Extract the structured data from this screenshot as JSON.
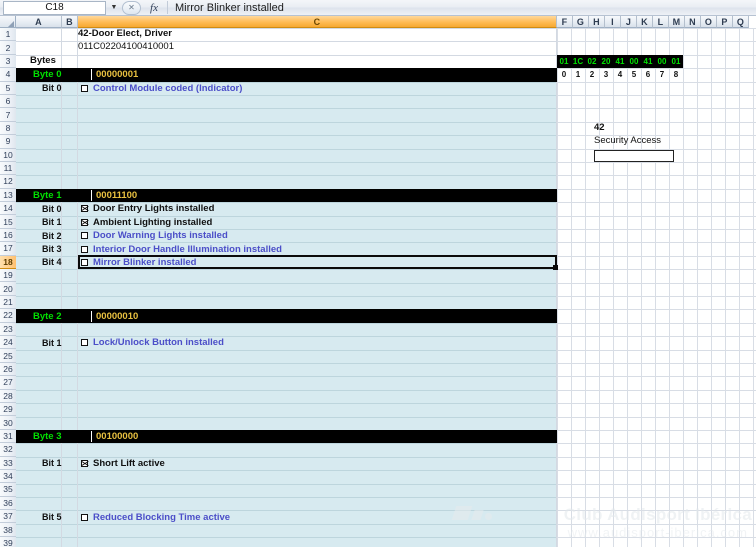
{
  "window": {
    "app": "spreadsheet"
  },
  "formula_bar": {
    "name_box_value": "C18",
    "dropdown_icon": "chevron-down-icon",
    "insert_function_icon": "fx-icon",
    "formula_value": "Mirror Blinker installed"
  },
  "columns": {
    "left": [
      "A",
      "B",
      "C"
    ],
    "right": [
      "F",
      "G",
      "H",
      "I",
      "J",
      "K",
      "L",
      "M",
      "N",
      "O",
      "P",
      "Q"
    ],
    "selected": "C"
  },
  "rows": {
    "first": 1,
    "last": 39,
    "selected": 18
  },
  "sheet": {
    "title": "42-Door Elect, Driver",
    "coding_string": "011C02204100410001",
    "bytes_label": "Bytes",
    "groups": [
      {
        "byte_label": "Byte 0",
        "binary": "00000001",
        "row": 4,
        "bits": [
          {
            "row": 5,
            "bit": "Bit 0",
            "checked": false,
            "text": "Control Module coded (Indicator)",
            "style": "blue"
          }
        ]
      },
      {
        "byte_label": "Byte 1",
        "binary": "00011100",
        "row": 13,
        "bits": [
          {
            "row": 14,
            "bit": "Bit 0",
            "checked": true,
            "text": "Door Entry Lights installed",
            "style": "black"
          },
          {
            "row": 15,
            "bit": "Bit 1",
            "checked": true,
            "text": "Ambient Lighting installed",
            "style": "black"
          },
          {
            "row": 16,
            "bit": "Bit 2",
            "checked": false,
            "text": "Door Warning Lights installed",
            "style": "blue"
          },
          {
            "row": 17,
            "bit": "Bit 3",
            "checked": false,
            "text": "Interior Door Handle Illumination installed",
            "style": "blue"
          },
          {
            "row": 18,
            "bit": "Bit 4",
            "checked": false,
            "text": "Mirror Blinker installed",
            "style": "blue"
          }
        ]
      },
      {
        "byte_label": "Byte 2",
        "binary": "00000010",
        "row": 22,
        "bits": [
          {
            "row": 24,
            "bit": "Bit 1",
            "checked": false,
            "text": "Lock/Unlock Button installed",
            "style": "blue"
          }
        ]
      },
      {
        "byte_label": "Byte 3",
        "binary": "00100000",
        "row": 31,
        "bits": [
          {
            "row": 33,
            "bit": "Bit 1",
            "checked": true,
            "text": "Short Lift active",
            "style": "black"
          },
          {
            "row": 37,
            "bit": "Bit 5",
            "checked": false,
            "text": "Reduced Blocking Time active",
            "style": "blue"
          }
        ]
      }
    ]
  },
  "hex_panel": {
    "row": 3,
    "values": [
      "01",
      "1C",
      "02",
      "20",
      "41",
      "00",
      "41",
      "00",
      "01"
    ],
    "indexes": [
      "0",
      "1",
      "2",
      "3",
      "4",
      "5",
      "6",
      "7",
      "8"
    ]
  },
  "security_access": {
    "number": "42",
    "label": "Security Access",
    "input_value": ""
  },
  "watermark": {
    "line1": "Club Audisport Ibérica",
    "line2": "www.audisport-iberica.com"
  },
  "colors": {
    "byte_bar_bg": "#000000",
    "byte_label_text": "#00e000",
    "binary_text": "#e8c040",
    "desc_blue": "#4b4ec8",
    "content_band": "#d7eaf0",
    "header_selected": "#ffbb55"
  }
}
